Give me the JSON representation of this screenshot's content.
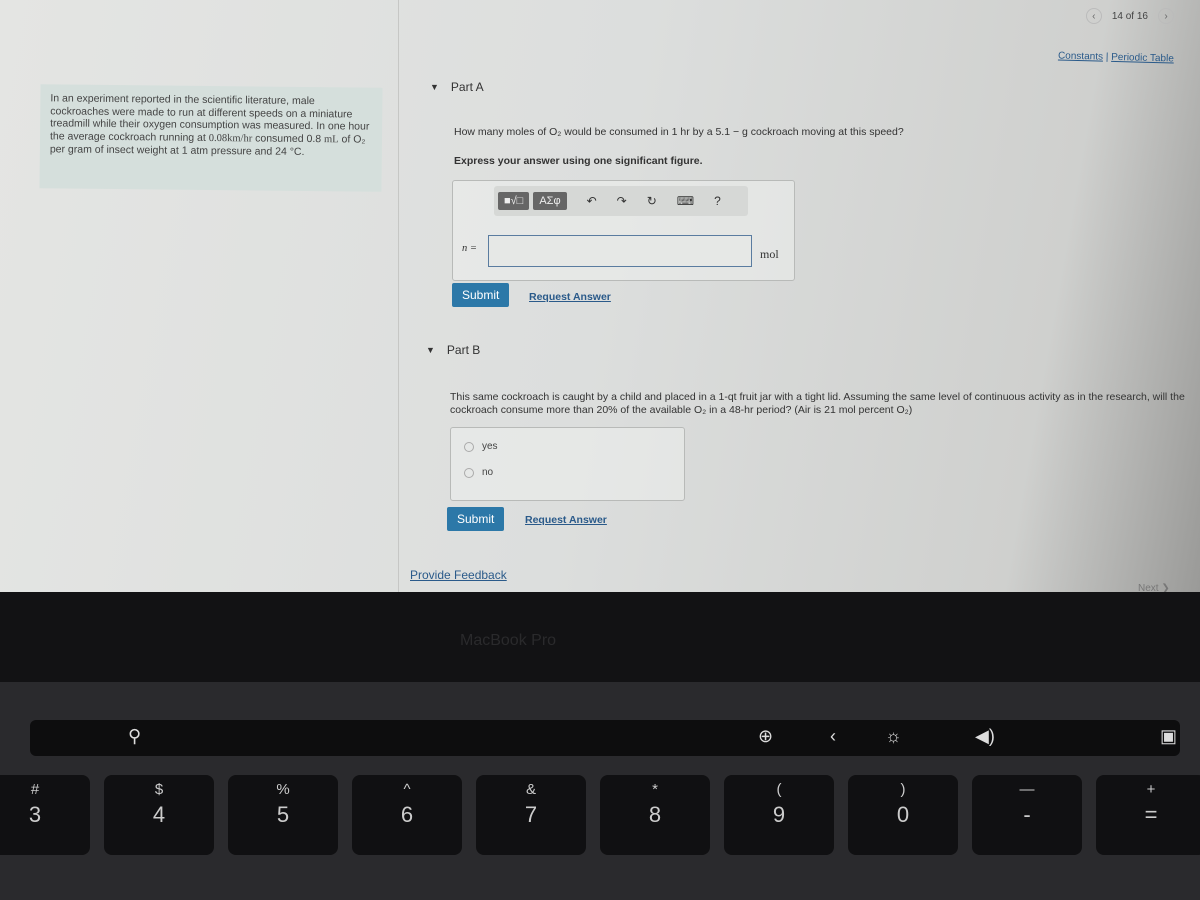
{
  "pagination": {
    "label": "14 of 16"
  },
  "resources": {
    "constants": "Constants",
    "separator": "|",
    "periodic_table": "Periodic Table"
  },
  "intro": {
    "text_pre": "In an experiment reported in the scientific literature, male cockroaches were made to run at different speeds on a miniature treadmill while their oxygen consumption was measured. In one hour the average cockroach running at ",
    "speed": "0.08km/hr",
    "text_mid": " consumed 0.8 ",
    "unit_ml": "mL",
    "text_mid2": " of O₂ per gram of insect weight at 1 atm pressure and 24 °C."
  },
  "part_a": {
    "title": "Part A",
    "question": "How many moles of O₂ would be consumed in 1 hr by a 5.1 − g cockroach moving at this speed?",
    "instruction": "Express your answer using one significant figure.",
    "toolbar": {
      "templates": "■√□",
      "greek": "ΑΣφ",
      "undo": "↶",
      "redo": "↷",
      "reset": "↻",
      "keyboard": "⌨",
      "help": "?"
    },
    "variable": "n =",
    "answer_value": "",
    "unit": "mol",
    "submit": "Submit",
    "request": "Request Answer"
  },
  "part_b": {
    "title": "Part B",
    "question": "This same cockroach is caught by a child and placed in a 1-qt fruit jar with a tight lid. Assuming the same level of continuous activity as in the research, will the cockroach consume more than 20% of the available O₂ in a 48-hr period? (Air is 21 mol percent O₂)",
    "options": [
      "yes",
      "no"
    ],
    "submit": "Submit",
    "request": "Request Answer"
  },
  "feedback": "Provide Feedback",
  "next": "Next ❯",
  "laptop": {
    "brand": "MacBook Pro",
    "keys": [
      {
        "s": "#",
        "m": "3"
      },
      {
        "s": "$",
        "m": "4"
      },
      {
        "s": "%",
        "m": "5"
      },
      {
        "s": "^",
        "m": "6"
      },
      {
        "s": "&",
        "m": "7"
      },
      {
        "s": "*",
        "m": "8"
      },
      {
        "s": "(",
        "m": "9"
      },
      {
        "s": ")",
        "m": "0"
      },
      {
        "s": "—",
        "m": "-"
      },
      {
        "s": "+",
        "m": "="
      }
    ]
  }
}
